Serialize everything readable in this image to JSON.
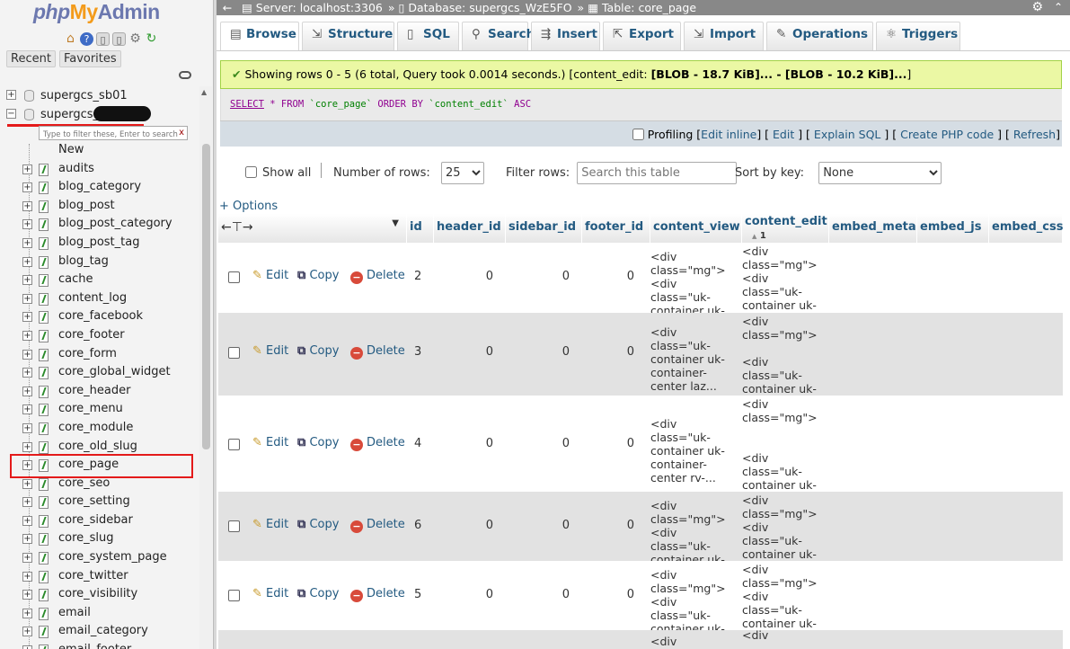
{
  "logo": {
    "php": "php",
    "my": "My",
    "admin": "Admin"
  },
  "sidebar": {
    "recent_label": "Recent",
    "favorites_label": "Favorites",
    "databases": [
      {
        "name": "supergcs_sb01",
        "expanded": false
      },
      {
        "name": "supergcs_",
        "expanded": true
      }
    ],
    "filter_placeholder": "Type to filter these, Enter to search",
    "filter_clear": "x",
    "new_label": "New",
    "tables": [
      "audits",
      "blog_category",
      "blog_post",
      "blog_post_category",
      "blog_post_tag",
      "blog_tag",
      "cache",
      "content_log",
      "core_facebook",
      "core_footer",
      "core_form",
      "core_global_widget",
      "core_header",
      "core_menu",
      "core_module",
      "core_old_slug",
      "core_page",
      "core_seo",
      "core_setting",
      "core_sidebar",
      "core_slug",
      "core_system_page",
      "core_twitter",
      "core_visibility",
      "email",
      "email_category",
      "email_footer"
    ],
    "selected_table": "core_page"
  },
  "topbar": {
    "server": "Server: localhost:3306",
    "database": "Database: supergcs_WzE5FO",
    "table": "Table: core_page",
    "sep": "»"
  },
  "tabs": [
    {
      "label": "Browse",
      "icon": "browse-icon",
      "active": true
    },
    {
      "label": "Structure",
      "icon": "structure-icon"
    },
    {
      "label": "SQL",
      "icon": "sql-icon"
    },
    {
      "label": "Search",
      "icon": "search-icon"
    },
    {
      "label": "Insert",
      "icon": "insert-icon"
    },
    {
      "label": "Export",
      "icon": "export-icon"
    },
    {
      "label": "Import",
      "icon": "import-icon"
    },
    {
      "label": "Operations",
      "icon": "operations-icon"
    },
    {
      "label": "Triggers",
      "icon": "triggers-icon"
    }
  ],
  "success": {
    "text": "Showing rows 0 - 5 (6 total, Query took 0.0014 seconds.) [content_edit: ",
    "bold": "[BLOB - 18.7 KiB]... - [BLOB - 10.2 KiB]...",
    "end": "]"
  },
  "sql": {
    "select": "SELECT",
    "star": " * ",
    "from": "FROM",
    "table": " `core_page` ",
    "order": "ORDER BY",
    "col": " `content_edit` ",
    "asc": "ASC"
  },
  "profiling": {
    "label": "Profiling",
    "links": [
      "Edit inline",
      "Edit",
      "Explain SQL",
      "Create PHP code",
      "Refresh"
    ]
  },
  "nav": {
    "show_all": "Show all",
    "num_rows_label": "Number of rows:",
    "num_rows_value": "25",
    "filter_label": "Filter rows:",
    "filter_placeholder": "Search this table",
    "sort_label": "Sort by key:",
    "sort_value": "None"
  },
  "options_label": "+ Options",
  "columns": [
    {
      "name": "id"
    },
    {
      "name": "header_id"
    },
    {
      "name": "sidebar_id"
    },
    {
      "name": "footer_id"
    },
    {
      "name": "content_view"
    },
    {
      "name": "content_edit",
      "sort": "1"
    },
    {
      "name": "embed_meta"
    },
    {
      "name": "embed_js"
    },
    {
      "name": "embed_css"
    }
  ],
  "actions": {
    "edit": "Edit",
    "copy": "Copy",
    "delete": "Delete"
  },
  "rows": [
    {
      "id": "2",
      "header_id": "0",
      "sidebar_id": "0",
      "footer_id": "0",
      "content_view": "<div class=\"mg\"> <div class=\"uk-container uk-cont...",
      "content_edit": "<div class=\"mg\"> <div class=\"uk-container uk-cont..."
    },
    {
      "id": "3",
      "header_id": "0",
      "sidebar_id": "0",
      "footer_id": "0",
      "content_view": "<div class=\"uk-container uk-container-center laz...",
      "content_edit": "<div class=\"mg\">\n\n<div class=\"uk-container uk-con..."
    },
    {
      "id": "4",
      "header_id": "0",
      "sidebar_id": "0",
      "footer_id": "0",
      "content_view": "<div class=\"uk-container uk-container-center rv-...",
      "content_edit": "<div class=\"mg\">\n\n\n<div class=\"uk-container uk-con..."
    },
    {
      "id": "6",
      "header_id": "0",
      "sidebar_id": "0",
      "footer_id": "0",
      "content_view": "<div class=\"mg\"> <div class=\"uk-container uk-conta...",
      "content_edit": "<div class=\"mg\"> <div class=\"uk-container uk-conta..."
    },
    {
      "id": "5",
      "header_id": "0",
      "sidebar_id": "0",
      "footer_id": "0",
      "content_view": "<div class=\"mg\"> <div class=\"uk-container uk-conta...",
      "content_edit": "<div class=\"mg\"> <div class=\"uk-container uk-conta..."
    },
    {
      "id": "",
      "header_id": "",
      "sidebar_id": "",
      "footer_id": "",
      "content_view": "<div",
      "content_edit": "<div"
    }
  ]
}
